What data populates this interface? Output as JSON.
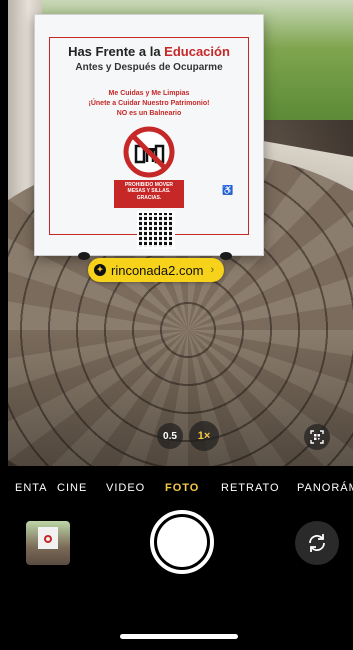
{
  "sign": {
    "title_main": "Has Frente a la ",
    "title_highlight": "Educación",
    "subtitle": "Antes y Después de Ocuparme",
    "line1": "Me Cuidas y Me Limpias",
    "line2": "¡Únete a Cuidar Nuestro Patrimonio!",
    "line3": "NO es un Balneario",
    "warning_l1": "PROHIBIDO MOVER",
    "warning_l2": "MESAS Y SILLAS.",
    "warning_l3": "GRACIAS."
  },
  "link_chip": {
    "text": "rinconada2.com",
    "icon": "compass-icon"
  },
  "zoom": {
    "option_ultrawide": "0.5",
    "option_wide": "1×",
    "selected": "1×"
  },
  "modes": {
    "items": [
      "ENTA",
      "CINE",
      "VIDEO",
      "FOTO",
      "RETRATO",
      "PANORÁMICA"
    ],
    "selected": "FOTO"
  },
  "colors": {
    "accent": "#f7c948",
    "link_chip": "#f7d21a",
    "sign_red": "#c62828"
  },
  "icons": {
    "qr_scan": "qr-scan-icon",
    "flip_camera": "camera-flip-icon"
  }
}
